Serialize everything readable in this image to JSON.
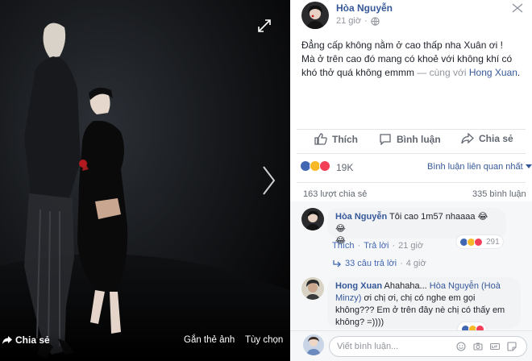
{
  "photo": {
    "share_label": "Chia sẻ",
    "tag_label": "Gắn thẻ ảnh",
    "options_label": "Tùy chọn",
    "expand_icon": "expand-icon",
    "next_icon": "chevron-right-icon"
  },
  "post": {
    "author": "Hòa Nguyễn",
    "time": "21 giờ",
    "audience_icon": "globe-icon",
    "text_line1": "Đẳng cấp không nằm ở cao thấp nha Xuân ơi !",
    "text_line2": "Mà ở trên cao đó mang có khoẻ với không khí có",
    "text_line3": "khó thở quá không emmm",
    "with_label": "— cùng với",
    "tagged": "Hong Xuan",
    "period": "."
  },
  "actions": {
    "like": "Thích",
    "comment": "Bình luận",
    "share": "Chia sẻ"
  },
  "reactions": {
    "count": "19K",
    "relevant": "Bình luận liên quan nhất",
    "colors": {
      "like": "#4267b2",
      "haha": "#f7b928",
      "love": "#f33e58"
    }
  },
  "stats": {
    "shares": "163 lượt chia sẻ",
    "comments": "335 bình luận"
  },
  "comments": [
    {
      "author": "Hòa Nguyễn",
      "text": "Tôi cao 1m57 nhaaaa 😂😂",
      "text2": "😂",
      "like": "Thích",
      "reply": "Trả lời",
      "time": "21 giờ",
      "reactions": "291",
      "replies": "33 câu trả lời",
      "replies_time": "4 giờ"
    },
    {
      "author": "Hong Xuan",
      "text_a": "Ahahaha...",
      "mention": "Hòa Nguyễn (Hoà",
      "mention2": "Minzy)",
      "text_b": "ơi chị ơi, chị có nghe em gọi",
      "text_c": "không??? Em ở trên đây nè chị có thấy em",
      "text_d": "không? =))))"
    }
  ],
  "composer": {
    "placeholder": "Viết bình luận..."
  }
}
